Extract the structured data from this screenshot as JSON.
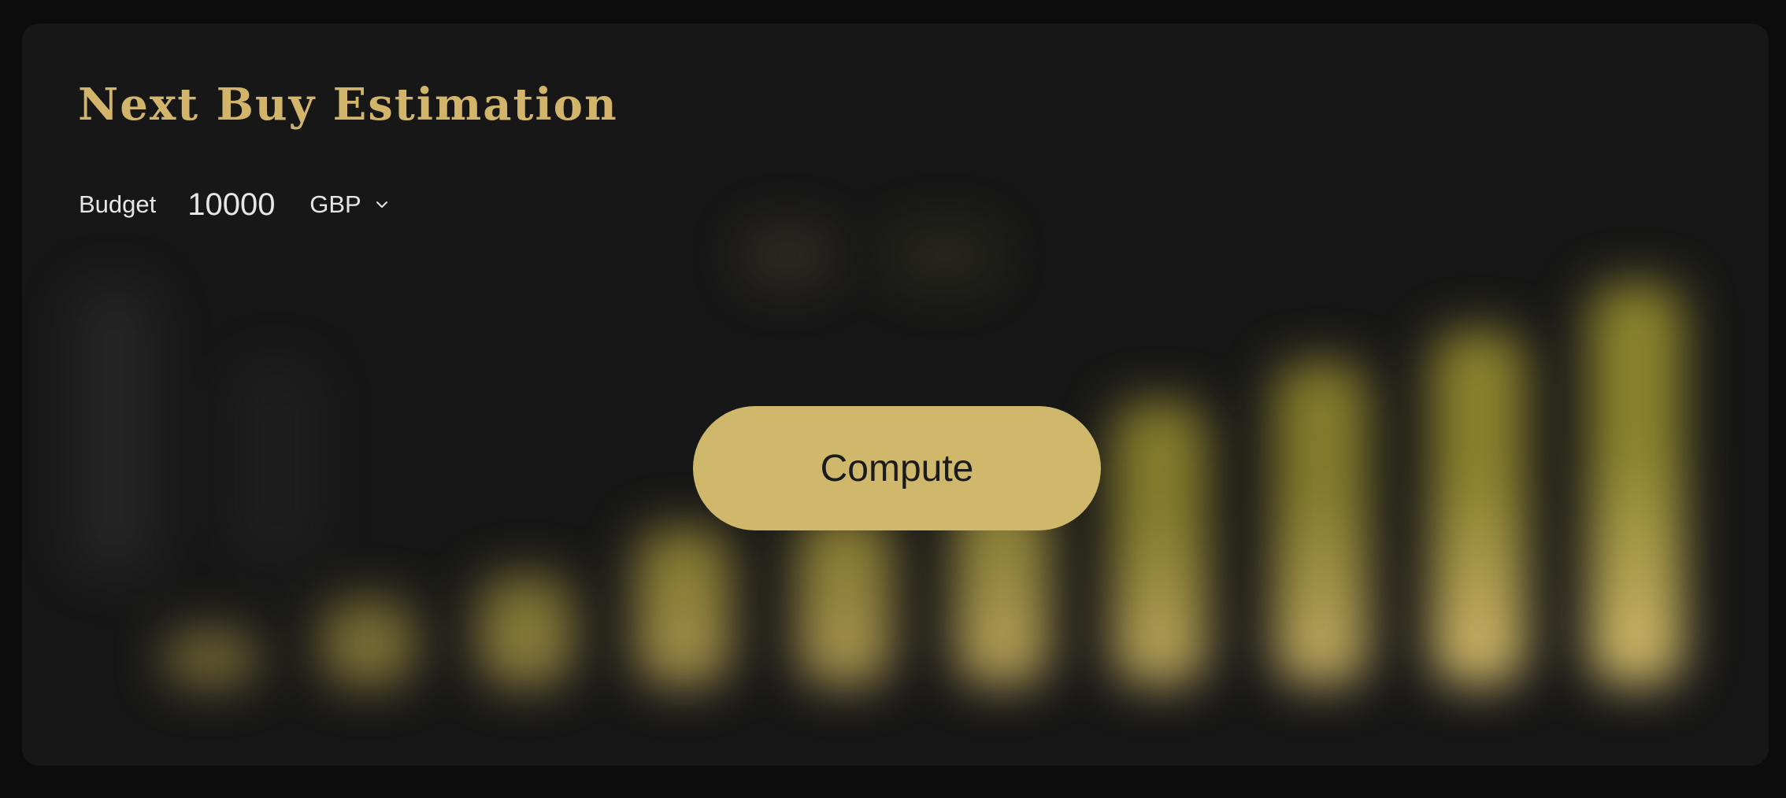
{
  "title": "Next Buy Estimation",
  "budget": {
    "label": "Budget",
    "value": "10000",
    "currency": "GBP"
  },
  "compute_button": {
    "label": "Compute"
  },
  "colors": {
    "accent": "#cfb86b",
    "title": "#d2b56a",
    "background": "#0c0c0c",
    "card": "#171717",
    "text": "#e6e6e6"
  },
  "icons": {
    "currency_dropdown": "chevron-down-icon"
  }
}
